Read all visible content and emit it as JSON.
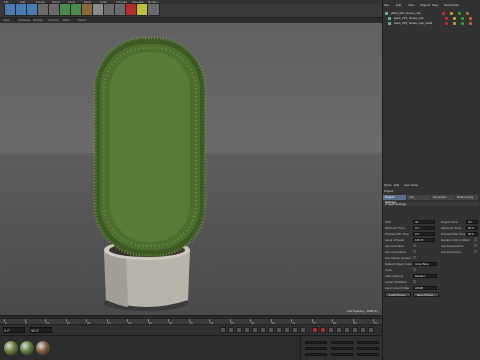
{
  "toolbar": {
    "menu": [
      "File",
      "Edit",
      "Create",
      "Select",
      "Tools",
      "Mesh",
      "Snap",
      "Animate",
      "Simulate",
      "Render"
    ],
    "frame_label": "P"
  },
  "viewport": {
    "menu": [
      "View",
      "Cameras",
      "Display",
      "Options",
      "Filter",
      "Panel"
    ],
    "footer_text": "Grid Spacing : 1000 cm"
  },
  "timeline": {
    "ticks": [
      "0",
      "5",
      "10",
      "15",
      "20",
      "25",
      "30",
      "35",
      "40",
      "45",
      "50",
      "55",
      "60",
      "65",
      "70",
      "75",
      "80",
      "85",
      "90"
    ],
    "start_field": "0 F",
    "end_field": "90 F"
  },
  "material_manager": {
    "balls": [
      {
        "color": "#6a7a3c"
      },
      {
        "color": "#5d7a3a"
      },
      {
        "color": "#7a5a3c"
      }
    ]
  },
  "object_manager": {
    "menu": [
      "File",
      "Edit",
      "View",
      "Objects",
      "Tags",
      "Bookmarks"
    ],
    "rows": [
      {
        "label": "plant_015_Grass_mat",
        "indent": 0
      },
      {
        "label": "plant_015_Grass_mat",
        "indent": 1
      },
      {
        "label": "plant_015_Grass_mat_mask",
        "indent": 1
      }
    ]
  },
  "attributes": {
    "menu": [
      "Mode",
      "Edit",
      "User Data"
    ],
    "object_title": "Project",
    "tabs": [
      "Project Settings",
      "Info",
      "Dynamics",
      "Referencing"
    ],
    "section": "Project Settings",
    "fields_left": [
      {
        "label": "FPS",
        "value": "30"
      },
      {
        "label": "Minimum Time",
        "value": "0 F"
      },
      {
        "label": "Preview Min Time",
        "value": "0 F"
      },
      {
        "label": "Level of Detail",
        "value": "100 %"
      },
      {
        "label": "Use Animation",
        "value": ""
      },
      {
        "label": "Use Generators",
        "value": ""
      },
      {
        "label": "Use Motion System",
        "value": ""
      }
    ],
    "fields_right": [
      {
        "label": "Project Time",
        "value": "0 F"
      },
      {
        "label": "Maximum Time",
        "value": "90 F"
      },
      {
        "label": "Preview Max Time",
        "value": "90 F"
      },
      {
        "label": "Render LOD in Editor",
        "value": ""
      },
      {
        "label": "Use Expressions",
        "value": ""
      },
      {
        "label": "Use Deformers",
        "value": ""
      }
    ],
    "lower": [
      {
        "label": "Default Object Color",
        "value": "Gray-Blue"
      },
      {
        "label": "Color",
        "value": ""
      },
      {
        "label": "View Clipping",
        "value": "Medium"
      },
      {
        "label": "Linear Workflow",
        "value": ""
      },
      {
        "label": "Input Color Profile",
        "value": "sRGB"
      }
    ],
    "buttons": [
      "Load Preset...",
      "Save Preset..."
    ]
  },
  "colors": {
    "accent": "#5c6e8c",
    "record": "#a03030"
  }
}
